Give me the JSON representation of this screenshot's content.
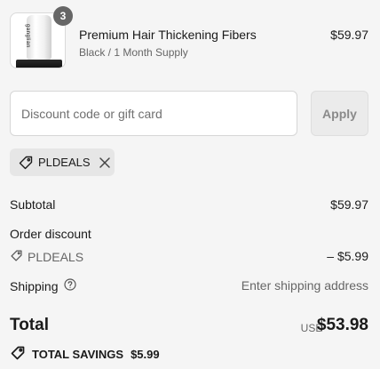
{
  "line_item": {
    "quantity": "3",
    "thumbnail_text": "ganglian",
    "name": "Premium Hair Thickening Fibers",
    "variant": "Black / 1 Month Supply",
    "price": "$59.97"
  },
  "discount": {
    "placeholder": "Discount code or gift card",
    "value": "",
    "apply_label": "Apply",
    "applied_code": "PLDEALS"
  },
  "summary": {
    "subtotal_label": "Subtotal",
    "subtotal_value": "$59.97",
    "order_discount_label": "Order discount",
    "discount_code": "PLDEALS",
    "discount_value": "– $5.99",
    "shipping_label": "Shipping",
    "shipping_value": "Enter shipping address",
    "total_label": "Total",
    "currency": "USD",
    "total_value": "$53.98",
    "savings_label": "TOTAL SAVINGS",
    "savings_value": "$5.99"
  },
  "icons": {
    "tag": "tag-icon",
    "remove": "close-icon",
    "help": "question-circle-icon"
  },
  "colors": {
    "background": "#f5f5f5",
    "badge": "#666666",
    "apply_button": "#ebebeb",
    "chip": "#e6e6e6",
    "muted_text": "#666666"
  }
}
